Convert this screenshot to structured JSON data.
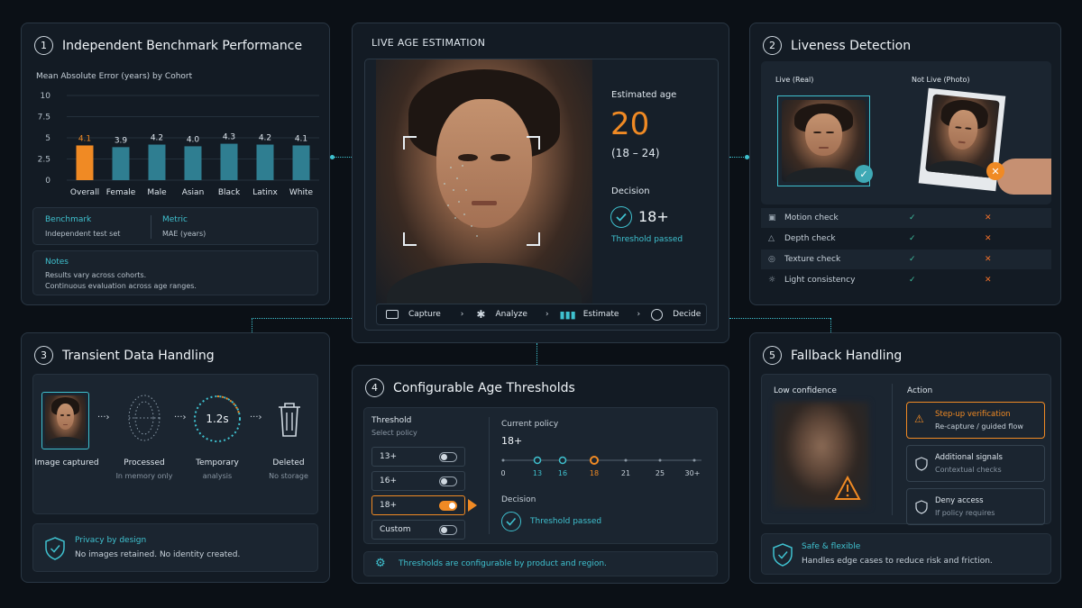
{
  "benchmark": {
    "num": "1",
    "title": "Independent Benchmark Performance",
    "chart_title": "Mean Absolute Error (years) by Cohort",
    "benchmark_label": "Benchmark",
    "benchmark_value": "Independent test set",
    "metric_label": "Metric",
    "metric_value": "MAE (years)",
    "notes_label": "Notes",
    "notes_line1": "Results vary across cohorts.",
    "notes_line2": "Continuous evaluation across age ranges."
  },
  "chart_data": {
    "type": "bar",
    "title": "Mean Absolute Error (years) by Cohort",
    "categories": [
      "Overall",
      "Female",
      "Male",
      "Asian",
      "Black",
      "Latinx",
      "White"
    ],
    "values": [
      4.1,
      3.9,
      4.2,
      4.0,
      4.3,
      4.2,
      4.1
    ],
    "value_labels": [
      "4.1",
      "3.9",
      "4.2",
      "4.0",
      "4.3",
      "4.2",
      "4.1"
    ],
    "y_ticks": [
      "10",
      "7.5",
      "5",
      "2.5",
      "0"
    ],
    "ylim": [
      0,
      10
    ],
    "highlight_index": 0,
    "colors": {
      "highlight": "#f08a24",
      "bar": "#2f7e91"
    }
  },
  "live": {
    "title": "LIVE AGE ESTIMATION",
    "estimated_label": "Estimated age",
    "age": "20",
    "range": "(18 – 24)",
    "decision_label": "Decision",
    "decision_value": "18+",
    "threshold_text": "Threshold passed",
    "steps": [
      "Capture",
      "Analyze",
      "Estimate",
      "Decide"
    ]
  },
  "liveness": {
    "num": "2",
    "title": "Liveness Detection",
    "live_label": "Live (Real)",
    "notlive_label": "Not Live (Photo)",
    "checks": [
      "Motion check",
      "Depth check",
      "Texture check",
      "Light consistency"
    ]
  },
  "transient": {
    "num": "3",
    "title": "Transient Data Handling",
    "steps": [
      {
        "label": "Image captured",
        "sub": ""
      },
      {
        "label": "Processed",
        "sub": "In memory only"
      },
      {
        "label": "Temporary",
        "sub": "analysis"
      },
      {
        "label": "Deleted",
        "sub": "No storage"
      }
    ],
    "timer": "1.2s",
    "privacy_title": "Privacy by design",
    "privacy_text": "No images retained. No identity created."
  },
  "thresholds": {
    "num": "4",
    "title": "Configurable Age Thresholds",
    "threshold_label": "Threshold",
    "select_label": "Select policy",
    "options": [
      "13+",
      "16+",
      "18+",
      "Custom"
    ],
    "selected_index": 2,
    "current_label": "Current policy",
    "current_value": "18+",
    "scale": [
      "0",
      "13",
      "16",
      "18",
      "21",
      "25",
      "30+"
    ],
    "decision_label": "Decision",
    "decision_text": "Threshold passed",
    "footer": "Thresholds are configurable by product and region."
  },
  "fallback": {
    "num": "5",
    "title": "Fallback Handling",
    "low_label": "Low confidence",
    "action_label": "Action",
    "actions": [
      {
        "title": "Step-up verification",
        "sub": "Re-capture / guided flow"
      },
      {
        "title": "Additional signals",
        "sub": "Contextual checks"
      },
      {
        "title": "Deny access",
        "sub": "If policy requires"
      }
    ],
    "safe_title": "Safe & flexible",
    "safe_text": "Handles edge cases to reduce risk and friction."
  },
  "colors": {
    "accent": "#3fc1cf",
    "orange": "#f08a24",
    "green": "#3fc1a0",
    "red": "#f0702a"
  }
}
